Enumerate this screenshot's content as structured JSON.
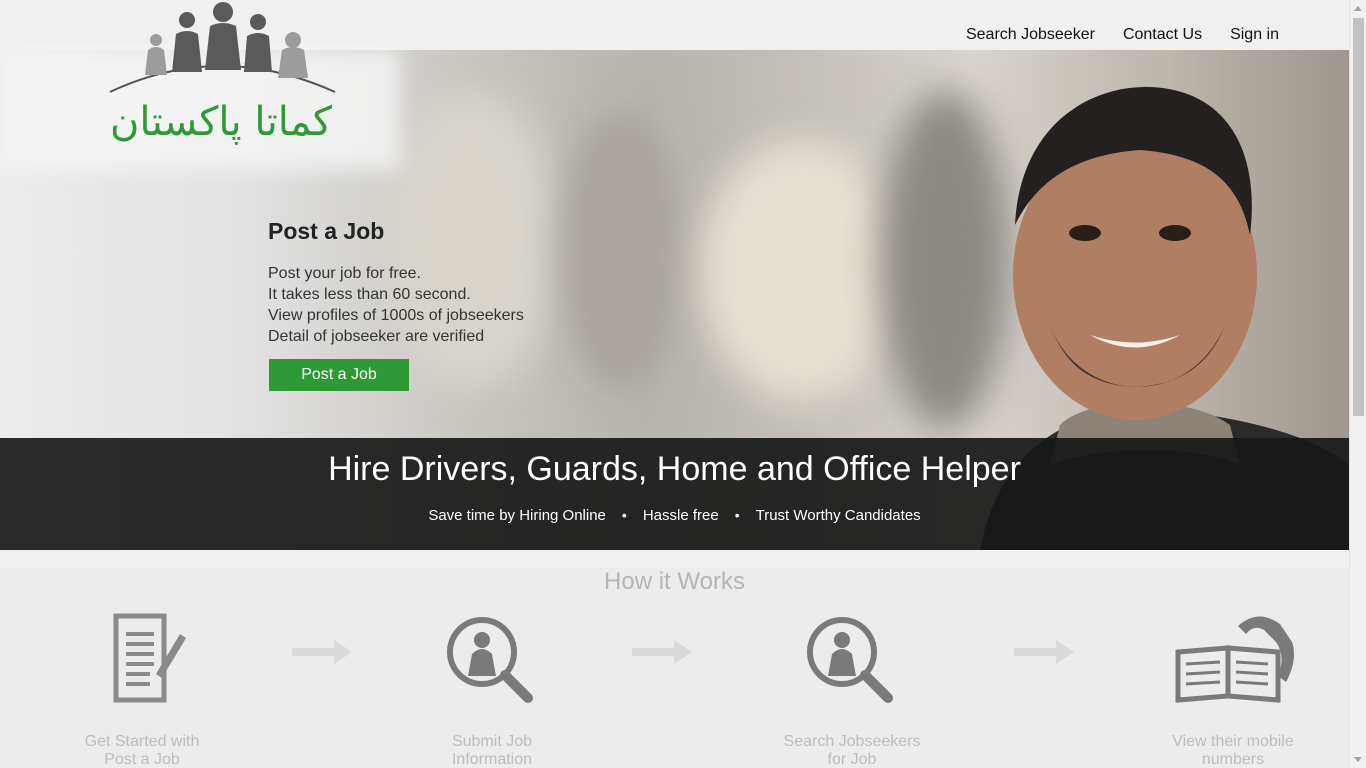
{
  "nav": {
    "search_jobseeker": "Search Jobseeker",
    "contact_us": "Contact Us",
    "sign_in": "Sign in"
  },
  "logo": {
    "urdu_text": "کماتا پاکستان",
    "icon": "people-silhouettes-logo"
  },
  "hero": {
    "title": "Post a Job",
    "lines": [
      "Post your job for free.",
      "It takes less than 60 second.",
      "View profiles of 1000s of jobseekers",
      "Detail of jobseeker are verified"
    ],
    "button": "Post a Job"
  },
  "band": {
    "title": "Hire Drivers, Guards, Home and Office Helper",
    "features": [
      "Save time by Hiring Online",
      "Hassle free",
      "Trust Worthy Candidates"
    ],
    "separator": "•"
  },
  "how": {
    "title": "How it Works",
    "steps": [
      {
        "icon": "document-pen-icon",
        "line1": "Get Started with",
        "line2": "Post a Job"
      },
      {
        "icon": "search-person-icon",
        "line1": "Submit Job",
        "line2": "Information"
      },
      {
        "icon": "search-person-icon",
        "line1": "Search Jobseekers",
        "line2": "for Job"
      },
      {
        "icon": "phone-book-icon",
        "line1": "View their mobile",
        "line2": "numbers"
      }
    ]
  },
  "colors": {
    "accent": "#2f9a35",
    "band": "#181818",
    "muted": "#bdbdbd"
  }
}
